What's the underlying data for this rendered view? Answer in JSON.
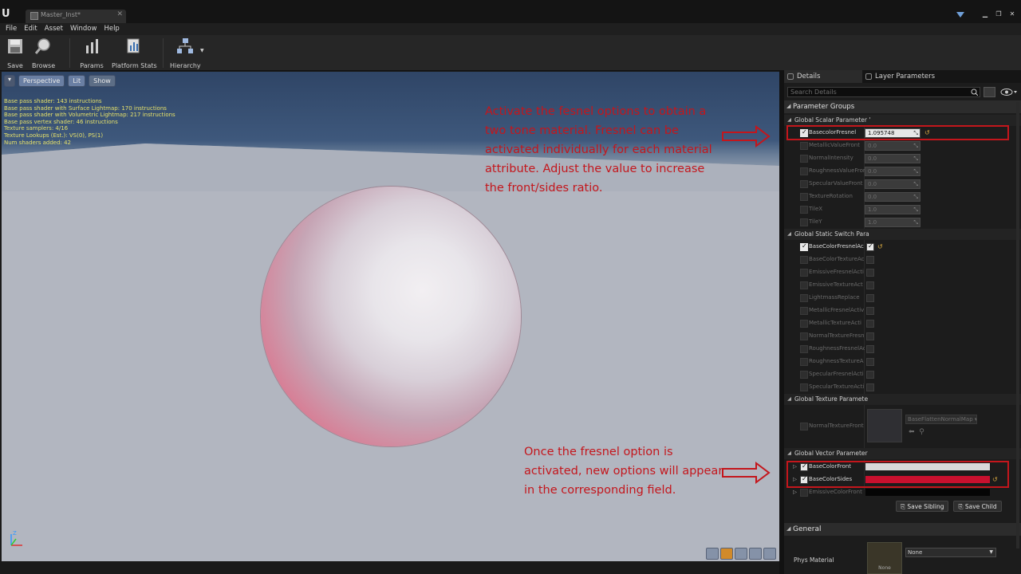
{
  "window": {
    "tab_title": "Master_Inst*",
    "controls": [
      "▁",
      "❐",
      "✕"
    ]
  },
  "menu": [
    "File",
    "Edit",
    "Asset",
    "Window",
    "Help"
  ],
  "toolbar": {
    "save": "Save",
    "browse": "Browse",
    "params": "Params",
    "platform_stats": "Platform Stats",
    "hierarchy": "Hierarchy"
  },
  "viewport": {
    "perspective": "Perspective",
    "lit": "Lit",
    "show": "Show",
    "stats": [
      "Base pass shader: 143 instructions",
      "Base pass shader with Surface Lightmap: 170 instructions",
      "Base pass shader with Volumetric Lightmap: 217 instructions",
      "Base pass vertex shader: 46 instructions",
      "Texture samplers: 4/16",
      "Texture Lookups (Est.): VS(0), PS(1)",
      "Num shaders added: 42"
    ],
    "annotation_1": "Activate the fesnel options to obtain a two tone material. Fresnel can be activated individually for each material attribute. Adjust the value to increase the front/sides ratio.",
    "annotation_2": "Once the fresnel option is activated, new options will appear in the corresponding field."
  },
  "details": {
    "tab_details": "Details",
    "tab_layers": "Layer Parameters",
    "search_placeholder": "Search Details",
    "parameter_groups": "Parameter Groups",
    "scalar_header": "Global Scalar Parameter '",
    "scalar_params": [
      {
        "name": "BasecolorFresnel",
        "value": "1.095748",
        "enabled": true
      },
      {
        "name": "MetallicValueFront",
        "value": "0.0",
        "enabled": false
      },
      {
        "name": "NormalIntensity",
        "value": "0.0",
        "enabled": false
      },
      {
        "name": "RoughnessValueFront",
        "value": "0.0",
        "enabled": false
      },
      {
        "name": "SpecularValueFront",
        "value": "0.0",
        "enabled": false
      },
      {
        "name": "TextureRotation",
        "value": "0.0",
        "enabled": false
      },
      {
        "name": "TileX",
        "value": "1.0",
        "enabled": false
      },
      {
        "name": "TileY",
        "value": "1.0",
        "enabled": false
      }
    ],
    "switch_header": "Global Static Switch Para",
    "switch_params": [
      {
        "name": "BaseColorFresnelAc",
        "enabled": true
      },
      {
        "name": "BaseColorTextureAc",
        "enabled": false
      },
      {
        "name": "EmissiveFresnelActi",
        "enabled": false
      },
      {
        "name": "EmissiveTextureAct",
        "enabled": false
      },
      {
        "name": "LightmassReplace",
        "enabled": false
      },
      {
        "name": "MetallicFresnelActiv",
        "enabled": false
      },
      {
        "name": "MetallicTextureActi",
        "enabled": false
      },
      {
        "name": "NormalTextureFresn",
        "enabled": false
      },
      {
        "name": "RoughnessFresnelAc",
        "enabled": false
      },
      {
        "name": "RoughnessTextureA",
        "enabled": false
      },
      {
        "name": "SpecularFresnelActi",
        "enabled": false
      },
      {
        "name": "SpecularTextureActi",
        "enabled": false
      }
    ],
    "texture_header": "Global Texture Paramete",
    "texture_param": {
      "name": "NormalTextureFront",
      "value": "BaseFlattenNormalMap"
    },
    "vector_header": "Global Vector Parameter",
    "vector_params": [
      {
        "name": "BaseColorFront",
        "enabled": true,
        "color": "#d9d9d9"
      },
      {
        "name": "BaseColorSides",
        "enabled": true,
        "color": "#c8102e"
      },
      {
        "name": "EmissiveColorFront",
        "enabled": false,
        "color": "#050505"
      }
    ],
    "save_sibling": "Save Sibling",
    "save_child": "Save Child",
    "general": "General",
    "parent_material": "Phys Material",
    "parent_thumb": "None",
    "parent_value": "None"
  },
  "colors": {
    "annotation": "#c4161c",
    "reset_arrow": "#d4a640"
  }
}
